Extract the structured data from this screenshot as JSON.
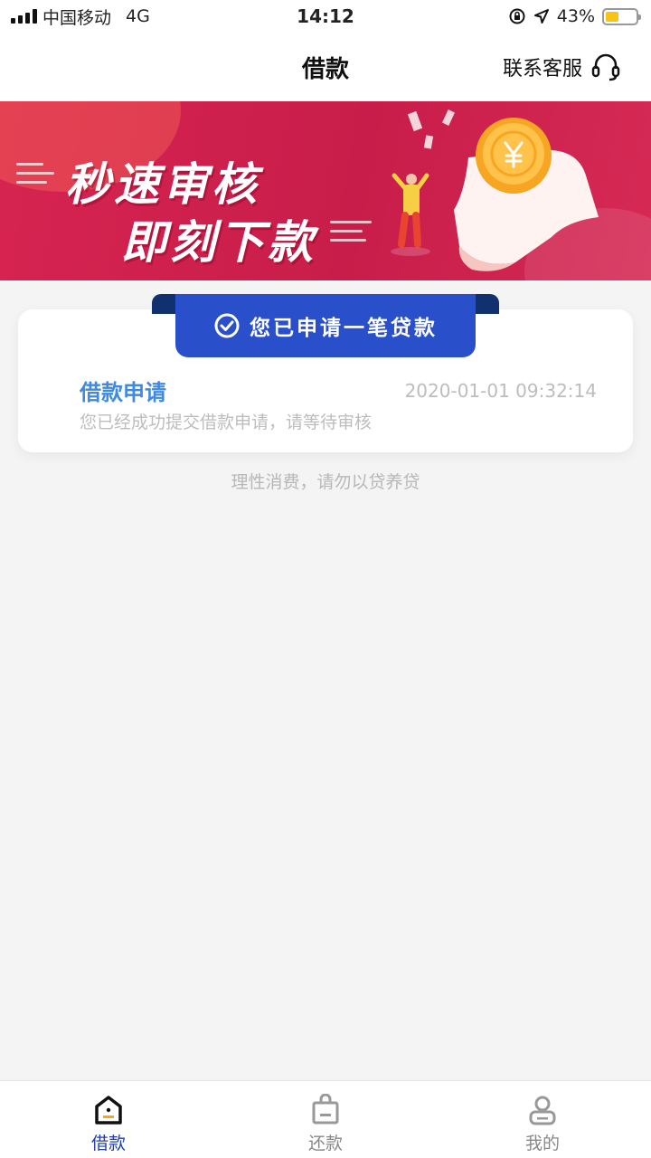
{
  "status_bar": {
    "carrier": "中国移动",
    "network": "4G",
    "time": "14:12",
    "battery": "43%",
    "battery_level": 0.43
  },
  "nav": {
    "title": "借款",
    "service_label": "联系客服"
  },
  "banner": {
    "line1": "秒速审核",
    "line2": "即刻下款"
  },
  "card": {
    "ribbon_text": "您已申请一笔贷款",
    "title": "借款申请",
    "time": "2020-01-01 09:32:14",
    "description": "您已经成功提交借款申请，请等待审核"
  },
  "tip": "理性消费，请勿以贷养贷",
  "tabs": [
    {
      "label": "借款",
      "icon": "home-icon",
      "active": true
    },
    {
      "label": "还款",
      "icon": "bag-icon",
      "active": false
    },
    {
      "label": "我的",
      "icon": "user-icon",
      "active": false
    }
  ],
  "colors": {
    "accent": "#2a4fcb",
    "banner": "#c81d4a",
    "title_blue": "#3f8ae0"
  }
}
